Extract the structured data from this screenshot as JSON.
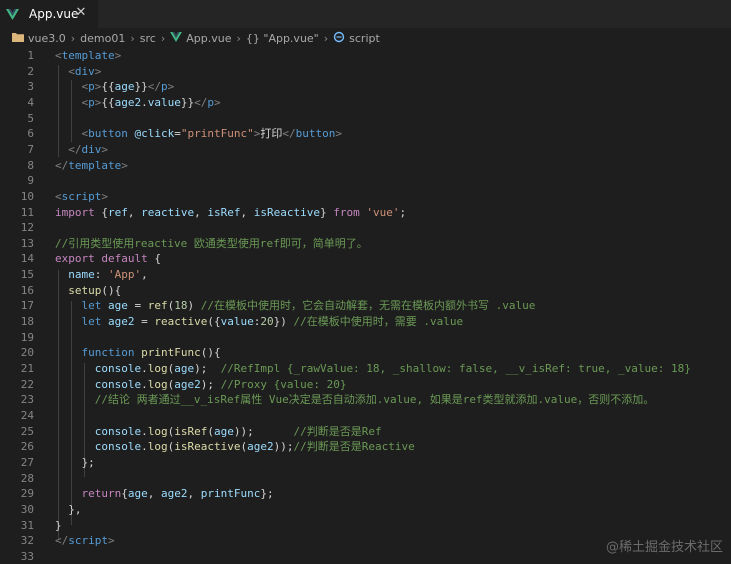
{
  "tab": {
    "label": "App.vue",
    "icon": "vue-logo-icon",
    "close": "✕"
  },
  "breadcrumb": {
    "items": [
      "vue3.0",
      "demo01",
      "src",
      "App.vue",
      "{} \"App.vue\"",
      "script"
    ],
    "separator": "›"
  },
  "colors": {
    "background": "#1e1e1e",
    "tabbar": "#252526",
    "vue_green": "#41b883",
    "folder_yellow": "#dcb67a"
  },
  "watermark": "@稀土掘金技术社区",
  "lines": [
    {
      "n": "1",
      "tokens": [
        {
          "c": "t-tag",
          "t": "<"
        },
        {
          "c": "t-tagname",
          "t": "template"
        },
        {
          "c": "t-tag",
          "t": ">"
        }
      ]
    },
    {
      "n": "2",
      "tokens": [
        {
          "c": "t-text",
          "t": "  "
        },
        {
          "c": "t-tag",
          "t": "<"
        },
        {
          "c": "t-tagname",
          "t": "div"
        },
        {
          "c": "t-tag",
          "t": ">"
        }
      ]
    },
    {
      "n": "3",
      "tokens": [
        {
          "c": "t-text",
          "t": "    "
        },
        {
          "c": "t-tag",
          "t": "<"
        },
        {
          "c": "t-tagname",
          "t": "p"
        },
        {
          "c": "t-tag",
          "t": ">"
        },
        {
          "c": "t-text",
          "t": "{{"
        },
        {
          "c": "t-var",
          "t": "age"
        },
        {
          "c": "t-text",
          "t": "}}"
        },
        {
          "c": "t-tag",
          "t": "</"
        },
        {
          "c": "t-tagname",
          "t": "p"
        },
        {
          "c": "t-tag",
          "t": ">"
        }
      ]
    },
    {
      "n": "4",
      "tokens": [
        {
          "c": "t-text",
          "t": "    "
        },
        {
          "c": "t-tag",
          "t": "<"
        },
        {
          "c": "t-tagname",
          "t": "p"
        },
        {
          "c": "t-tag",
          "t": ">"
        },
        {
          "c": "t-text",
          "t": "{{"
        },
        {
          "c": "t-var",
          "t": "age2"
        },
        {
          "c": "t-text",
          "t": "."
        },
        {
          "c": "t-var",
          "t": "value"
        },
        {
          "c": "t-text",
          "t": "}}"
        },
        {
          "c": "t-tag",
          "t": "</"
        },
        {
          "c": "t-tagname",
          "t": "p"
        },
        {
          "c": "t-tag",
          "t": ">"
        }
      ]
    },
    {
      "n": "5",
      "tokens": []
    },
    {
      "n": "6",
      "tokens": [
        {
          "c": "t-text",
          "t": "    "
        },
        {
          "c": "t-tag",
          "t": "<"
        },
        {
          "c": "t-tagname",
          "t": "button"
        },
        {
          "c": "t-text",
          "t": " "
        },
        {
          "c": "t-attr",
          "t": "@click"
        },
        {
          "c": "t-text",
          "t": "="
        },
        {
          "c": "t-str",
          "t": "\"printFunc\""
        },
        {
          "c": "t-tag",
          "t": ">"
        },
        {
          "c": "t-text",
          "t": "打印"
        },
        {
          "c": "t-tag",
          "t": "</"
        },
        {
          "c": "t-tagname",
          "t": "button"
        },
        {
          "c": "t-tag",
          "t": ">"
        }
      ]
    },
    {
      "n": "7",
      "tokens": [
        {
          "c": "t-text",
          "t": "  "
        },
        {
          "c": "t-tag",
          "t": "</"
        },
        {
          "c": "t-tagname",
          "t": "div"
        },
        {
          "c": "t-tag",
          "t": ">"
        }
      ]
    },
    {
      "n": "8",
      "tokens": [
        {
          "c": "t-tag",
          "t": "</"
        },
        {
          "c": "t-tagname",
          "t": "template"
        },
        {
          "c": "t-tag",
          "t": ">"
        }
      ]
    },
    {
      "n": "9",
      "tokens": []
    },
    {
      "n": "10",
      "tokens": [
        {
          "c": "t-tag",
          "t": "<"
        },
        {
          "c": "t-tagname",
          "t": "script"
        },
        {
          "c": "t-tag",
          "t": ">"
        }
      ]
    },
    {
      "n": "11",
      "tokens": [
        {
          "c": "t-kw",
          "t": "import"
        },
        {
          "c": "t-text",
          "t": " {"
        },
        {
          "c": "t-var",
          "t": "ref"
        },
        {
          "c": "t-text",
          "t": ", "
        },
        {
          "c": "t-var",
          "t": "reactive"
        },
        {
          "c": "t-text",
          "t": ", "
        },
        {
          "c": "t-var",
          "t": "isRef"
        },
        {
          "c": "t-text",
          "t": ", "
        },
        {
          "c": "t-var",
          "t": "isReactive"
        },
        {
          "c": "t-text",
          "t": "} "
        },
        {
          "c": "t-kw",
          "t": "from"
        },
        {
          "c": "t-text",
          "t": " "
        },
        {
          "c": "t-str",
          "t": "'vue'"
        },
        {
          "c": "t-text",
          "t": ";"
        }
      ]
    },
    {
      "n": "12",
      "tokens": []
    },
    {
      "n": "13",
      "tokens": [
        {
          "c": "t-com",
          "t": "//引用类型使用reactive 欧通类型使用ref即可，简单明了。"
        }
      ]
    },
    {
      "n": "14",
      "tokens": [
        {
          "c": "t-kw",
          "t": "export"
        },
        {
          "c": "t-text",
          "t": " "
        },
        {
          "c": "t-kw",
          "t": "default"
        },
        {
          "c": "t-text",
          "t": " {"
        }
      ]
    },
    {
      "n": "15",
      "tokens": [
        {
          "c": "t-text",
          "t": "  "
        },
        {
          "c": "t-var",
          "t": "name"
        },
        {
          "c": "t-text",
          "t": ": "
        },
        {
          "c": "t-str",
          "t": "'App'"
        },
        {
          "c": "t-text",
          "t": ","
        }
      ]
    },
    {
      "n": "16",
      "tokens": [
        {
          "c": "t-text",
          "t": "  "
        },
        {
          "c": "t-fn",
          "t": "setup"
        },
        {
          "c": "t-text",
          "t": "(){"
        }
      ]
    },
    {
      "n": "17",
      "tokens": [
        {
          "c": "t-text",
          "t": "    "
        },
        {
          "c": "t-blue",
          "t": "let"
        },
        {
          "c": "t-text",
          "t": " "
        },
        {
          "c": "t-var",
          "t": "age"
        },
        {
          "c": "t-text",
          "t": " = "
        },
        {
          "c": "t-fn",
          "t": "ref"
        },
        {
          "c": "t-text",
          "t": "("
        },
        {
          "c": "t-num",
          "t": "18"
        },
        {
          "c": "t-text",
          "t": ") "
        },
        {
          "c": "t-com",
          "t": "//在模板中使用时，它会自动解套，无需在模板内额外书写 .value"
        }
      ]
    },
    {
      "n": "18",
      "tokens": [
        {
          "c": "t-text",
          "t": "    "
        },
        {
          "c": "t-blue",
          "t": "let"
        },
        {
          "c": "t-text",
          "t": " "
        },
        {
          "c": "t-var",
          "t": "age2"
        },
        {
          "c": "t-text",
          "t": " = "
        },
        {
          "c": "t-fn",
          "t": "reactive"
        },
        {
          "c": "t-text",
          "t": "({"
        },
        {
          "c": "t-var",
          "t": "value"
        },
        {
          "c": "t-text",
          "t": ":"
        },
        {
          "c": "t-num",
          "t": "20"
        },
        {
          "c": "t-text",
          "t": "}) "
        },
        {
          "c": "t-com",
          "t": "//在模板中使用时，需要 .value"
        }
      ]
    },
    {
      "n": "19",
      "tokens": []
    },
    {
      "n": "20",
      "tokens": [
        {
          "c": "t-text",
          "t": "    "
        },
        {
          "c": "t-blue",
          "t": "function"
        },
        {
          "c": "t-text",
          "t": " "
        },
        {
          "c": "t-fn",
          "t": "printFunc"
        },
        {
          "c": "t-text",
          "t": "(){"
        }
      ]
    },
    {
      "n": "21",
      "tokens": [
        {
          "c": "t-text",
          "t": "      "
        },
        {
          "c": "t-var",
          "t": "console"
        },
        {
          "c": "t-text",
          "t": "."
        },
        {
          "c": "t-fn",
          "t": "log"
        },
        {
          "c": "t-text",
          "t": "("
        },
        {
          "c": "t-var",
          "t": "age"
        },
        {
          "c": "t-text",
          "t": ");  "
        },
        {
          "c": "t-com",
          "t": "//RefImpl {_rawValue: 18, _shallow: false, __v_isRef: true, _value: 18}"
        }
      ]
    },
    {
      "n": "22",
      "tokens": [
        {
          "c": "t-text",
          "t": "      "
        },
        {
          "c": "t-var",
          "t": "console"
        },
        {
          "c": "t-text",
          "t": "."
        },
        {
          "c": "t-fn",
          "t": "log"
        },
        {
          "c": "t-text",
          "t": "("
        },
        {
          "c": "t-var",
          "t": "age2"
        },
        {
          "c": "t-text",
          "t": "); "
        },
        {
          "c": "t-com",
          "t": "//Proxy {value: 20}"
        }
      ]
    },
    {
      "n": "23",
      "tokens": [
        {
          "c": "t-text",
          "t": "      "
        },
        {
          "c": "t-com",
          "t": "//结论 两者通过__v_isRef属性 Vue决定是否自动添加.value, 如果是ref类型就添加.value，否则不添加。"
        }
      ]
    },
    {
      "n": "24",
      "tokens": []
    },
    {
      "n": "25",
      "tokens": [
        {
          "c": "t-text",
          "t": "      "
        },
        {
          "c": "t-var",
          "t": "console"
        },
        {
          "c": "t-text",
          "t": "."
        },
        {
          "c": "t-fn",
          "t": "log"
        },
        {
          "c": "t-text",
          "t": "("
        },
        {
          "c": "t-fn",
          "t": "isRef"
        },
        {
          "c": "t-text",
          "t": "("
        },
        {
          "c": "t-var",
          "t": "age"
        },
        {
          "c": "t-text",
          "t": "));      "
        },
        {
          "c": "t-com",
          "t": "//判断是否是Ref"
        }
      ]
    },
    {
      "n": "26",
      "tokens": [
        {
          "c": "t-text",
          "t": "      "
        },
        {
          "c": "t-var",
          "t": "console"
        },
        {
          "c": "t-text",
          "t": "."
        },
        {
          "c": "t-fn",
          "t": "log"
        },
        {
          "c": "t-text",
          "t": "("
        },
        {
          "c": "t-fn",
          "t": "isReactive"
        },
        {
          "c": "t-text",
          "t": "("
        },
        {
          "c": "t-var",
          "t": "age2"
        },
        {
          "c": "t-text",
          "t": "));"
        },
        {
          "c": "t-com",
          "t": "//判断是否是Reactive"
        }
      ]
    },
    {
      "n": "27",
      "tokens": [
        {
          "c": "t-text",
          "t": "    };"
        }
      ]
    },
    {
      "n": "28",
      "tokens": []
    },
    {
      "n": "29",
      "tokens": [
        {
          "c": "t-text",
          "t": "    "
        },
        {
          "c": "t-kw",
          "t": "return"
        },
        {
          "c": "t-text",
          "t": "{"
        },
        {
          "c": "t-var",
          "t": "age"
        },
        {
          "c": "t-text",
          "t": ", "
        },
        {
          "c": "t-var",
          "t": "age2"
        },
        {
          "c": "t-text",
          "t": ", "
        },
        {
          "c": "t-var",
          "t": "printFunc"
        },
        {
          "c": "t-text",
          "t": "};"
        }
      ]
    },
    {
      "n": "30",
      "tokens": [
        {
          "c": "t-text",
          "t": "  },"
        }
      ]
    },
    {
      "n": "31",
      "tokens": [
        {
          "c": "t-text",
          "t": "}"
        }
      ]
    },
    {
      "n": "32",
      "tokens": [
        {
          "c": "t-tag",
          "t": "</"
        },
        {
          "c": "t-tagname",
          "t": "script"
        },
        {
          "c": "t-tag",
          "t": ">"
        }
      ]
    },
    {
      "n": "33",
      "tokens": []
    }
  ]
}
